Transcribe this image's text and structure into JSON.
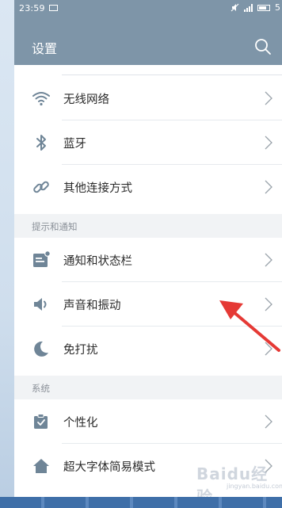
{
  "status_bar": {
    "time": "23:59",
    "battery": "5"
  },
  "header": {
    "title": "设置",
    "search_icon": "search-icon"
  },
  "colors": {
    "header_bg": "#7e95a8",
    "icon": "#6f8597",
    "section_bg": "#f1f3f5",
    "annotation_arrow": "#e53935"
  },
  "sections": [
    {
      "title": "",
      "items": [
        {
          "label": "无线网络",
          "icon": "wifi-icon"
        },
        {
          "label": "蓝牙",
          "icon": "bluetooth-icon"
        },
        {
          "label": "其他连接方式",
          "icon": "link-icon"
        }
      ]
    },
    {
      "title": "提示和通知",
      "items": [
        {
          "label": "通知和状态栏",
          "icon": "notification-icon"
        },
        {
          "label": "声音和振动",
          "icon": "speaker-icon"
        },
        {
          "label": "免打扰",
          "icon": "moon-icon"
        }
      ]
    },
    {
      "title": "系统",
      "items": [
        {
          "label": "个性化",
          "icon": "personalize-icon"
        },
        {
          "label": "超大字体简易模式",
          "icon": "home-icon"
        }
      ]
    }
  ],
  "watermark": {
    "brand": "Baidu经验",
    "url": "jingyan.baidu.com"
  }
}
